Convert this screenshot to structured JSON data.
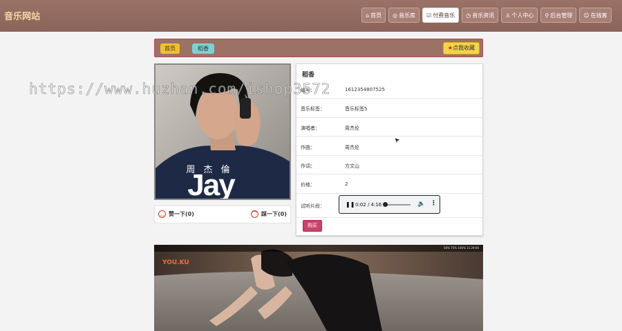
{
  "header": {
    "brand": "音乐网站",
    "nav": [
      {
        "icon": "home-icon",
        "glyph": "⌂",
        "label": "首页",
        "active": false
      },
      {
        "icon": "music-library-icon",
        "glyph": "◎",
        "label": "音乐库",
        "active": false
      },
      {
        "icon": "paid-music-icon",
        "glyph": "☑",
        "label": "付费音乐",
        "active": true
      },
      {
        "icon": "news-icon",
        "glyph": "◷",
        "label": "音乐资讯",
        "active": false
      },
      {
        "icon": "user-icon",
        "glyph": "♙",
        "label": "个人中心",
        "active": false
      },
      {
        "icon": "admin-icon",
        "glyph": "⚲",
        "label": "后台管理",
        "active": false
      },
      {
        "icon": "online-service-icon",
        "glyph": "☺",
        "label": "在线客",
        "active": false
      }
    ]
  },
  "breadcrumb": {
    "home": "首页",
    "current": "稻香",
    "favorite_label": "点我收藏",
    "favorite_icon": "star-icon"
  },
  "cover": {
    "artist_cn": "周 杰 倫",
    "artist_en": "Jay"
  },
  "votes": {
    "like": "赞一下(0)",
    "dislike": "踩一下(0)"
  },
  "song": {
    "title": "稻香",
    "rows": [
      {
        "key": "编号：",
        "value": "1612354807525"
      },
      {
        "key": "音乐标签：",
        "value": "音乐标签5"
      },
      {
        "key": "演唱者：",
        "value": "周杰伦"
      },
      {
        "key": "作曲：",
        "value": "周杰伦"
      },
      {
        "key": "作词：",
        "value": "方文山"
      },
      {
        "key": "价格：",
        "value": "2"
      },
      {
        "key": "试听片段：",
        "value": ""
      }
    ],
    "buy_label": "购买"
  },
  "audio": {
    "time": "0:02 / 4:16",
    "progress_fraction": 0.008
  },
  "video": {
    "logo": "YOU.KU",
    "stats": "58%  75%  100%  11:29:06"
  },
  "watermark": "https://www.huzhan.com/ishop3572"
}
